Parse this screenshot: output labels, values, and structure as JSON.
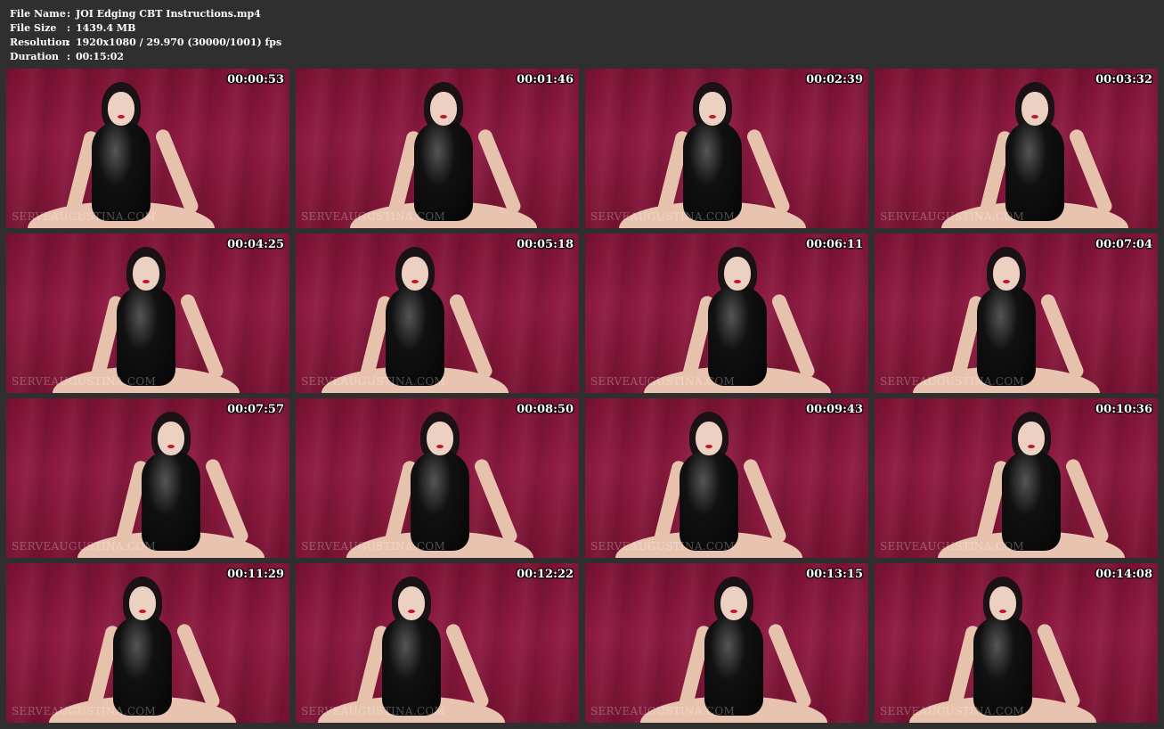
{
  "info": {
    "file_name_label": "File Name",
    "file_name_value": "JOI Edging CBT Instructions.mp4",
    "file_size_label": "File Size",
    "file_size_value": "1439.4 MB",
    "resolution_label": "Resolution",
    "resolution_value": "1920x1080 / 29.970 (30000/1001) fps",
    "duration_label": "Duration",
    "duration_value": "00:15:02",
    "separator": ":"
  },
  "thumbnails": [
    {
      "timestamp": "00:00:53",
      "watermark": "SERVEAUGUSTINA.COM"
    },
    {
      "timestamp": "00:01:46",
      "watermark": "SERVEAUGUSTINA.COM"
    },
    {
      "timestamp": "00:02:39",
      "watermark": "SERVEAUGUSTINA.COM"
    },
    {
      "timestamp": "00:03:32",
      "watermark": "SERVEAUGUSTINA.COM"
    },
    {
      "timestamp": "00:04:25",
      "watermark": "SERVEAUGUSTINA.COM"
    },
    {
      "timestamp": "00:05:18",
      "watermark": "SERVEAUGUSTINA.COM"
    },
    {
      "timestamp": "00:06:11",
      "watermark": "SERVEAUGUSTINA.COM"
    },
    {
      "timestamp": "00:07:04",
      "watermark": "SERVEAUGUSTINA.COM"
    },
    {
      "timestamp": "00:07:57",
      "watermark": "SERVEAUGUSTINA.COM"
    },
    {
      "timestamp": "00:08:50",
      "watermark": "SERVEAUGUSTINA.COM"
    },
    {
      "timestamp": "00:09:43",
      "watermark": "SERVEAUGUSTINA.COM"
    },
    {
      "timestamp": "00:10:36",
      "watermark": "SERVEAUGUSTINA.COM"
    },
    {
      "timestamp": "00:11:29",
      "watermark": "SERVEAUGUSTINA.COM"
    },
    {
      "timestamp": "00:12:22",
      "watermark": "SERVEAUGUSTINA.COM"
    },
    {
      "timestamp": "00:13:15",
      "watermark": "SERVEAUGUSTINA.COM"
    },
    {
      "timestamp": "00:14:08",
      "watermark": "SERVEAUGUSTINA.COM"
    }
  ],
  "colors": {
    "page_background": "#2f2f2f",
    "backdrop": "#8f1b42",
    "text": "#ffffff"
  }
}
